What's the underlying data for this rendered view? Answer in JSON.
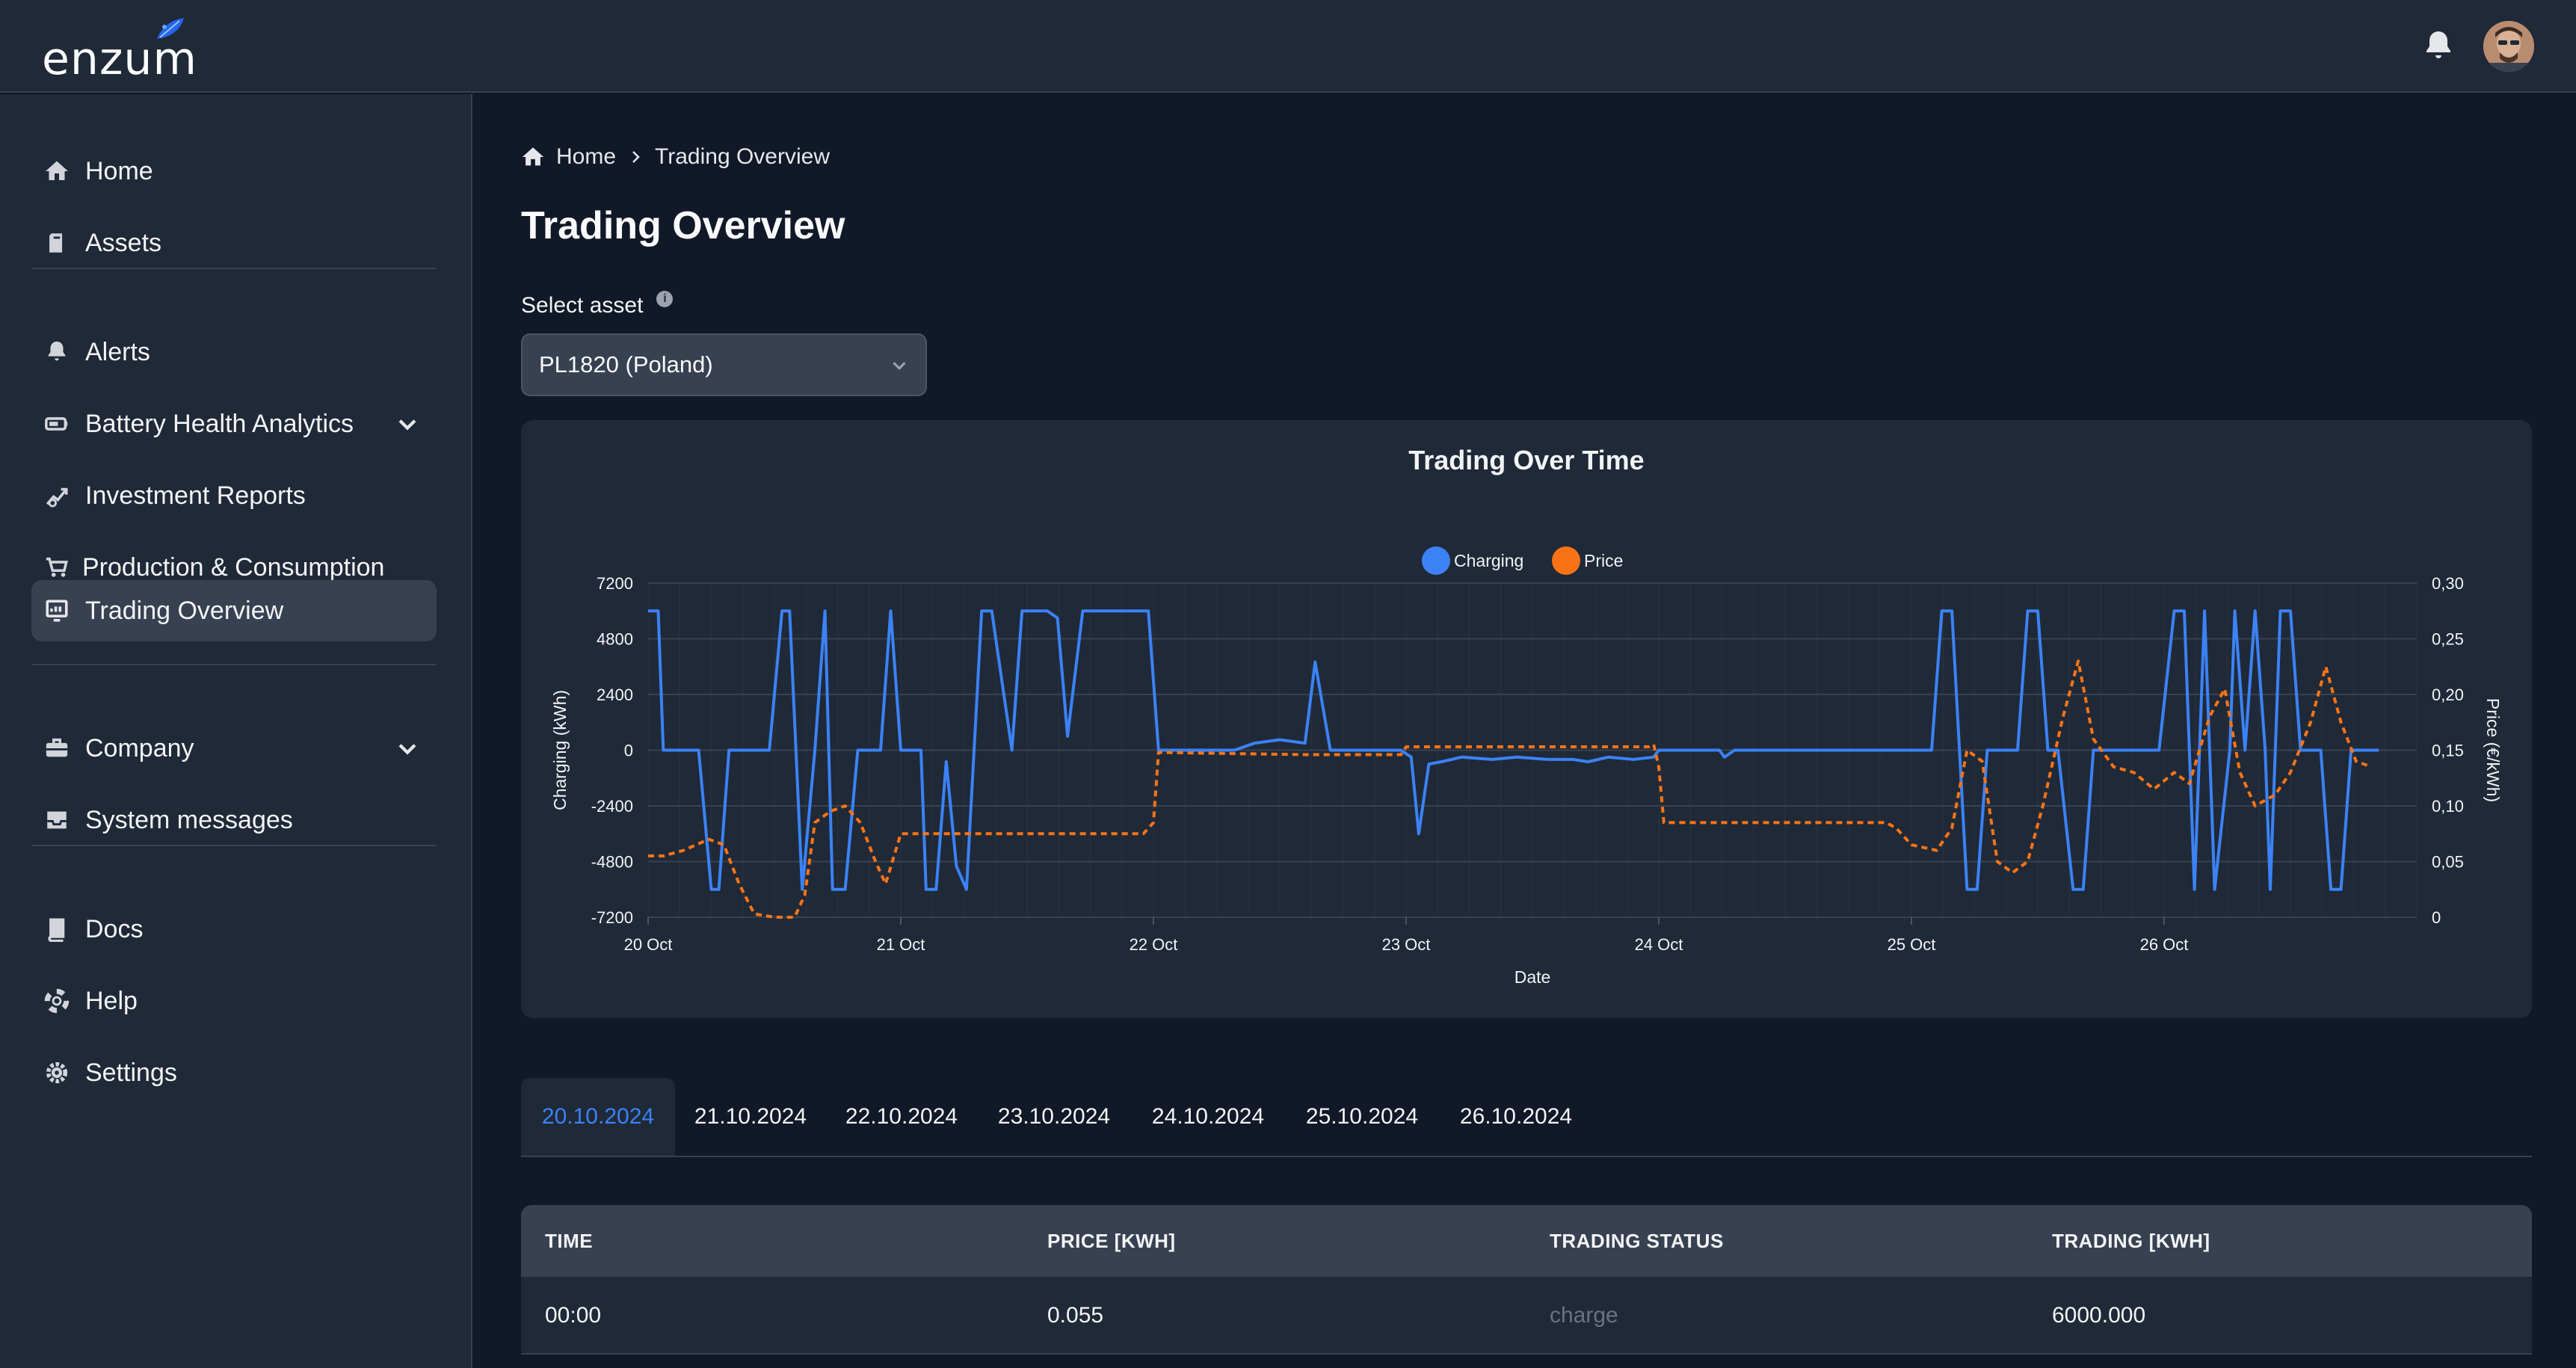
{
  "app": {
    "logo_text": "enzum",
    "colors": {
      "accent": "#3b82f6",
      "price": "#f97316",
      "background": "#111827",
      "panel": "#1f2937",
      "active": "#374151"
    }
  },
  "header": {
    "notifications_icon": "bell-icon",
    "avatar_icon": "user-avatar"
  },
  "sidebar": {
    "items": [
      {
        "label": "Home",
        "icon": "home-icon"
      },
      {
        "label": "Assets",
        "icon": "assets-icon"
      },
      {
        "label": "Alerts",
        "icon": "bell-icon"
      },
      {
        "label": "Battery Health Analytics",
        "icon": "battery-icon",
        "expandable": true
      },
      {
        "label": "Investment Reports",
        "icon": "chart-up-icon"
      },
      {
        "label": "Production & Consumption",
        "icon": "cart-icon"
      },
      {
        "label": "Trading Overview",
        "icon": "trading-icon",
        "active": true
      },
      {
        "label": "Company",
        "icon": "briefcase-icon",
        "expandable": true
      },
      {
        "label": "System messages",
        "icon": "inbox-icon"
      },
      {
        "label": "Docs",
        "icon": "book-icon"
      },
      {
        "label": "Help",
        "icon": "lifebuoy-icon"
      },
      {
        "label": "Settings",
        "icon": "gear-icon"
      }
    ]
  },
  "breadcrumb": {
    "home": "Home",
    "current": "Trading Overview"
  },
  "page": {
    "title": "Trading Overview"
  },
  "asset_select": {
    "label": "Select asset",
    "info": "i",
    "value": "PL1820 (Poland)"
  },
  "chart_data": {
    "type": "line",
    "title": "Trading Over Time",
    "xlabel": "Date",
    "ylabel": "Charging (kWh)",
    "y2label": "Price (€/kWh)",
    "x_tick_labels": [
      "20 Oct",
      "21 Oct",
      "22 Oct",
      "23 Oct",
      "24 Oct",
      "25 Oct",
      "26 Oct"
    ],
    "y_tick_labels": [
      "7200",
      "4800",
      "2400",
      "0",
      "-2400",
      "-4800",
      "-7200"
    ],
    "y2_tick_labels": [
      "0,30",
      "0,25",
      "0,20",
      "0,15",
      "0,10",
      "0,05",
      "0"
    ],
    "ylim": [
      -7200,
      7200
    ],
    "y2lim": [
      0,
      0.3
    ],
    "legend_position": "top-center",
    "x_range_days": [
      0,
      7
    ],
    "series": [
      {
        "name": "Charging",
        "axis": "left",
        "style": "solid",
        "color": "#3b82f6",
        "points": [
          [
            0.0,
            6000
          ],
          [
            0.04,
            6000
          ],
          [
            0.06,
            0
          ],
          [
            0.2,
            0
          ],
          [
            0.25,
            -6000
          ],
          [
            0.28,
            -6000
          ],
          [
            0.32,
            0
          ],
          [
            0.48,
            0
          ],
          [
            0.53,
            6000
          ],
          [
            0.56,
            6000
          ],
          [
            0.61,
            -6000
          ],
          [
            0.66,
            0
          ],
          [
            0.7,
            6000
          ],
          [
            0.73,
            -6000
          ],
          [
            0.78,
            -6000
          ],
          [
            0.83,
            0
          ],
          [
            0.92,
            0
          ],
          [
            0.96,
            6000
          ],
          [
            1.0,
            0
          ],
          [
            1.08,
            0
          ],
          [
            1.1,
            -6000
          ],
          [
            1.14,
            -6000
          ],
          [
            1.18,
            -500
          ],
          [
            1.22,
            -5000
          ],
          [
            1.26,
            -6000
          ],
          [
            1.32,
            6000
          ],
          [
            1.36,
            6000
          ],
          [
            1.44,
            0
          ],
          [
            1.48,
            6000
          ],
          [
            1.58,
            6000
          ],
          [
            1.62,
            5700
          ],
          [
            1.66,
            600
          ],
          [
            1.72,
            6000
          ],
          [
            1.98,
            6000
          ],
          [
            2.02,
            0
          ],
          [
            2.32,
            0
          ],
          [
            2.4,
            300
          ],
          [
            2.5,
            450
          ],
          [
            2.6,
            300
          ],
          [
            2.64,
            3800
          ],
          [
            2.7,
            0
          ],
          [
            2.98,
            0
          ],
          [
            3.02,
            -300
          ],
          [
            3.05,
            -3600
          ],
          [
            3.09,
            -600
          ],
          [
            3.14,
            -500
          ],
          [
            3.22,
            -300
          ],
          [
            3.34,
            -400
          ],
          [
            3.44,
            -300
          ],
          [
            3.56,
            -400
          ],
          [
            3.66,
            -400
          ],
          [
            3.72,
            -500
          ],
          [
            3.8,
            -300
          ],
          [
            3.9,
            -400
          ],
          [
            3.98,
            -300
          ],
          [
            4.0,
            0
          ],
          [
            4.24,
            0
          ],
          [
            4.26,
            -300
          ],
          [
            4.3,
            0
          ],
          [
            5.08,
            0
          ],
          [
            5.12,
            6000
          ],
          [
            5.16,
            6000
          ],
          [
            5.22,
            -6000
          ],
          [
            5.26,
            -6000
          ],
          [
            5.3,
            0
          ],
          [
            5.42,
            0
          ],
          [
            5.46,
            6000
          ],
          [
            5.5,
            6000
          ],
          [
            5.54,
            0
          ],
          [
            5.58,
            0
          ],
          [
            5.64,
            -6000
          ],
          [
            5.68,
            -6000
          ],
          [
            5.72,
            0
          ],
          [
            5.98,
            0
          ],
          [
            6.04,
            6000
          ],
          [
            6.08,
            6000
          ],
          [
            6.12,
            -6000
          ],
          [
            6.16,
            6000
          ],
          [
            6.2,
            -6000
          ],
          [
            6.26,
            0
          ],
          [
            6.28,
            6000
          ],
          [
            6.32,
            0
          ],
          [
            6.36,
            6000
          ],
          [
            6.4,
            0
          ],
          [
            6.42,
            -6000
          ],
          [
            6.46,
            6000
          ],
          [
            6.5,
            6000
          ],
          [
            6.54,
            0
          ],
          [
            6.62,
            0
          ],
          [
            6.66,
            -6000
          ],
          [
            6.7,
            -6000
          ],
          [
            6.74,
            0
          ],
          [
            6.8,
            0
          ],
          [
            6.85,
            0
          ]
        ]
      },
      {
        "name": "Price",
        "axis": "right",
        "style": "dashed",
        "color": "#f97316",
        "points": [
          [
            0.0,
            0.055
          ],
          [
            0.06,
            0.055
          ],
          [
            0.14,
            0.06
          ],
          [
            0.24,
            0.07
          ],
          [
            0.3,
            0.065
          ],
          [
            0.36,
            0.03
          ],
          [
            0.42,
            0.003
          ],
          [
            0.5,
            0.0
          ],
          [
            0.58,
            0.0
          ],
          [
            0.62,
            0.02
          ],
          [
            0.66,
            0.085
          ],
          [
            0.72,
            0.095
          ],
          [
            0.78,
            0.1
          ],
          [
            0.84,
            0.085
          ],
          [
            0.9,
            0.05
          ],
          [
            0.94,
            0.03
          ],
          [
            1.0,
            0.075
          ],
          [
            1.2,
            0.075
          ],
          [
            1.5,
            0.075
          ],
          [
            1.8,
            0.075
          ],
          [
            1.96,
            0.075
          ],
          [
            2.0,
            0.085
          ],
          [
            2.02,
            0.148
          ],
          [
            2.3,
            0.147
          ],
          [
            2.6,
            0.146
          ],
          [
            2.9,
            0.146
          ],
          [
            2.98,
            0.146
          ],
          [
            3.0,
            0.153
          ],
          [
            3.5,
            0.153
          ],
          [
            3.96,
            0.153
          ],
          [
            3.98,
            0.155
          ],
          [
            4.0,
            0.135
          ],
          [
            4.02,
            0.085
          ],
          [
            4.06,
            0.085
          ],
          [
            4.5,
            0.085
          ],
          [
            4.9,
            0.085
          ],
          [
            4.94,
            0.08
          ],
          [
            5.0,
            0.065
          ],
          [
            5.1,
            0.06
          ],
          [
            5.16,
            0.08
          ],
          [
            5.22,
            0.15
          ],
          [
            5.28,
            0.14
          ],
          [
            5.34,
            0.05
          ],
          [
            5.4,
            0.04
          ],
          [
            5.46,
            0.05
          ],
          [
            5.52,
            0.1
          ],
          [
            5.6,
            0.18
          ],
          [
            5.66,
            0.23
          ],
          [
            5.72,
            0.16
          ],
          [
            5.8,
            0.135
          ],
          [
            5.88,
            0.13
          ],
          [
            5.96,
            0.115
          ],
          [
            6.04,
            0.13
          ],
          [
            6.1,
            0.12
          ],
          [
            6.18,
            0.18
          ],
          [
            6.24,
            0.205
          ],
          [
            6.3,
            0.13
          ],
          [
            6.36,
            0.1
          ],
          [
            6.44,
            0.11
          ],
          [
            6.5,
            0.13
          ],
          [
            6.58,
            0.175
          ],
          [
            6.64,
            0.225
          ],
          [
            6.7,
            0.175
          ],
          [
            6.76,
            0.14
          ],
          [
            6.82,
            0.135
          ]
        ]
      }
    ]
  },
  "tabs": [
    "20.10.2024",
    "21.10.2024",
    "22.10.2024",
    "23.10.2024",
    "24.10.2024",
    "25.10.2024",
    "26.10.2024"
  ],
  "table": {
    "headers": [
      "TIME",
      "PRICE [KWH]",
      "TRADING STATUS",
      "TRADING [KWH]"
    ],
    "rows": [
      {
        "time": "00:00",
        "price": "0.055",
        "status": "charge",
        "trading": "6000.000"
      }
    ]
  }
}
